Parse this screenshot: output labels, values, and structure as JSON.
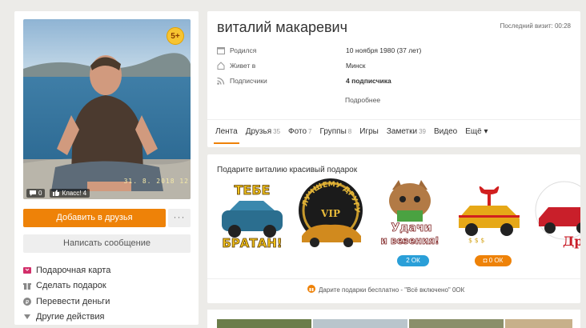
{
  "profile": {
    "name": "виталий макаревич",
    "last_visit": "Последний визит: 00:28",
    "level_badge": "5+",
    "photo_date": "31. 8. 2018  12",
    "photo_comments": "0",
    "photo_likes": "Класс! 4",
    "info": [
      {
        "icon": "calendar-icon",
        "label": "Родился",
        "value": "10 ноября 1980 (37 лет)",
        "bold": false
      },
      {
        "icon": "house-icon",
        "label": "Живет в",
        "value": "Минск",
        "bold": false
      },
      {
        "icon": "rss-icon",
        "label": "Подписчики",
        "value": "4 подписчика",
        "bold": true
      }
    ],
    "more_link": "Подробнее"
  },
  "left_panel": {
    "add_friend": "Добавить в друзья",
    "more_dots": "···",
    "write_message": "Написать сообщение",
    "actions": [
      {
        "icon": "gift-card-icon",
        "label": "Подарочная карта",
        "color": "#d22e6a"
      },
      {
        "icon": "gift-icon",
        "label": "Сделать подарок",
        "color": "#888888"
      },
      {
        "icon": "money-icon",
        "label": "Перевести деньги",
        "color": "#888888"
      },
      {
        "icon": "triangle-down-icon",
        "label": "Другие действия",
        "color": "#888888"
      }
    ]
  },
  "tabs": [
    {
      "label": "Лента",
      "count": "",
      "active": true
    },
    {
      "label": "Друзья",
      "count": "35",
      "active": false
    },
    {
      "label": "Фото",
      "count": "7",
      "active": false
    },
    {
      "label": "Группы",
      "count": "8",
      "active": false
    },
    {
      "label": "Игры",
      "count": "",
      "active": false
    },
    {
      "label": "Заметки",
      "count": "39",
      "active": false
    },
    {
      "label": "Видео",
      "count": "",
      "active": false
    },
    {
      "label": "Ещё ▾",
      "count": "",
      "active": false
    }
  ],
  "gifts": {
    "title": "Подарите виталию красивый подарок",
    "items": [
      {
        "name": "gift-tebe-bratan",
        "text_top": "ТЕБЕ",
        "text_bottom": "БРАТАН!"
      },
      {
        "name": "gift-luchshemu-drugu",
        "text_top": "ЛУЧШЕМУ ДРУГУ",
        "text_bottom": "VIP"
      },
      {
        "name": "gift-udachi",
        "text_top": "Удачи",
        "text_bottom": "и везения!"
      },
      {
        "name": "gift-car-bow",
        "text_top": "",
        "text_bottom": ""
      },
      {
        "name": "gift-dru",
        "text_top": "",
        "text_bottom": "Дру"
      }
    ],
    "price_blue": "2 ОК",
    "price_orange": "0 ОК",
    "footer": "Дарите подарки бесплатно - \"Всё включено\" 0ОК"
  },
  "colors": {
    "accent": "#ee8208",
    "blue": "#2a9fd8",
    "background": "#ecebe8"
  }
}
